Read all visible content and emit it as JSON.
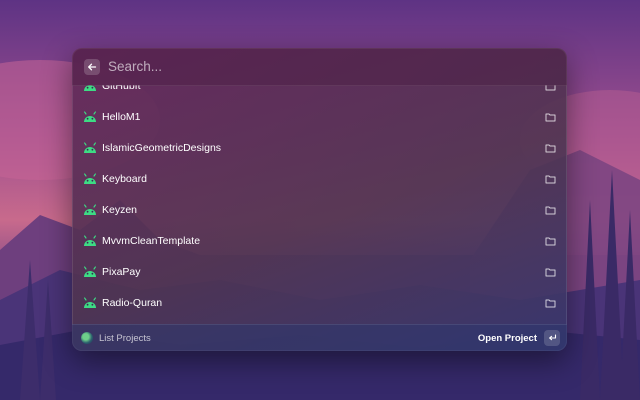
{
  "search": {
    "placeholder": "Search..."
  },
  "projects": [
    {
      "name": "GitHubIt"
    },
    {
      "name": "HelloM1"
    },
    {
      "name": "IslamicGeometricDesigns"
    },
    {
      "name": "Keyboard"
    },
    {
      "name": "Keyzen"
    },
    {
      "name": "MvvmCleanTemplate"
    },
    {
      "name": "PixaPay"
    },
    {
      "name": "Radio-Quran"
    },
    {
      "name": ""
    }
  ],
  "footer": {
    "command_title": "List Projects",
    "action_label": "Open Project"
  },
  "colors": {
    "android_green": "#3ddc84",
    "text": "#ffffff"
  },
  "icons": {
    "back": "arrow-left-icon",
    "project": "android-icon",
    "open": "folder-icon",
    "enter": "return-key-icon"
  }
}
